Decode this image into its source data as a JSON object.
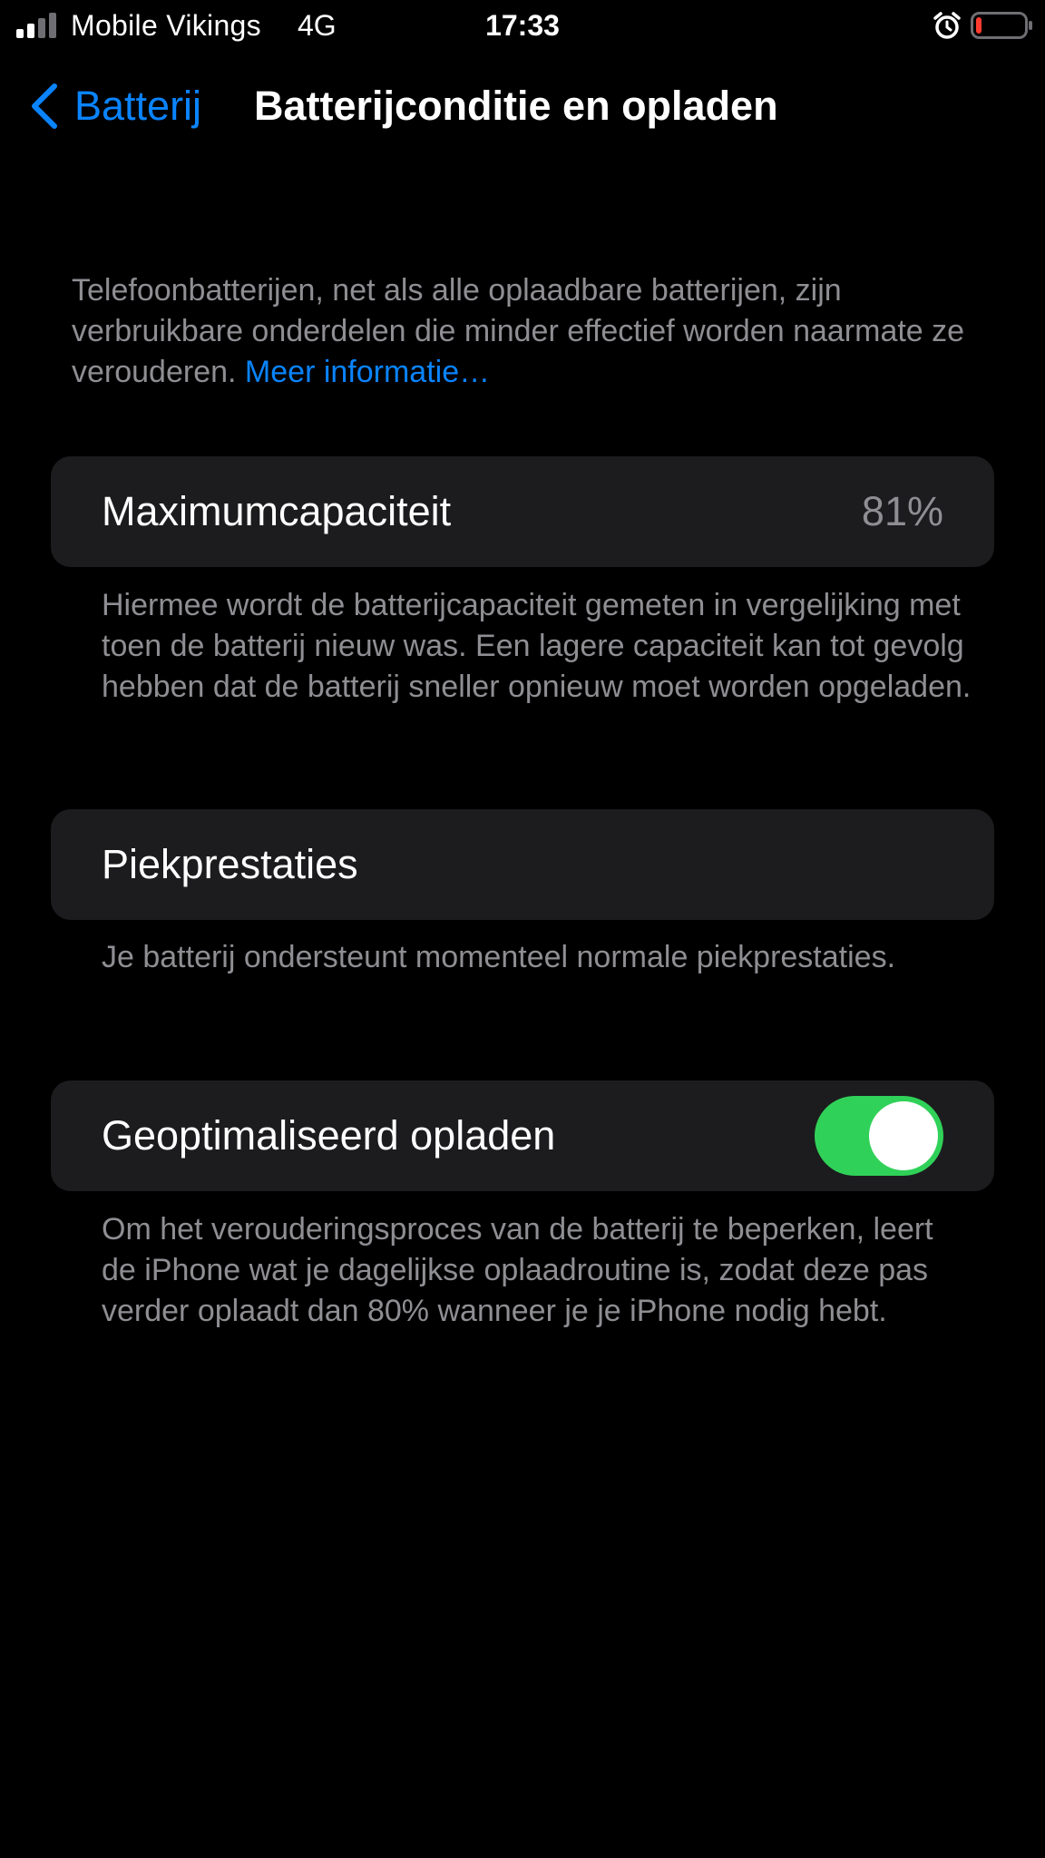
{
  "status_bar": {
    "carrier": "Mobile Vikings",
    "network": "4G",
    "time": "17:33",
    "signal_level": 2,
    "signal_max": 4,
    "battery_level": 0.12,
    "battery_color": "#ff3b30",
    "icons": [
      "signal-icon",
      "alarm-icon",
      "battery-icon"
    ]
  },
  "nav": {
    "back_label": "Batterij",
    "title": "Batterijconditie en opladen",
    "accent_color": "#0a84ff"
  },
  "intro": {
    "text": "Telefoonbatterijen, net als alle oplaadbare batterijen, zijn verbruikbare onderdelen die minder effectief worden naarmate ze verouderen.",
    "link": "Meer informatie…"
  },
  "max_capacity": {
    "label": "Maximumcapaciteit",
    "value": "81%",
    "footer": "Hiermee wordt de batterijcapaciteit gemeten in vergelijking met toen de batterij nieuw was. Een lagere capaciteit kan tot gevolg hebben dat de batterij sneller opnieuw moet worden opgeladen."
  },
  "peak_performance": {
    "label": "Piekprestaties",
    "footer": "Je batterij ondersteunt momenteel normale piekprestaties."
  },
  "optimized_charging": {
    "label": "Geoptimaliseerd opladen",
    "enabled": true,
    "toggle_color": "#30d158",
    "footer": "Om het verouderingsproces van de batterij te beperken, leert de iPhone wat je dagelijkse oplaadroutine is, zodat deze pas verder oplaadt dan 80% wanneer je je iPhone nodig hebt."
  }
}
